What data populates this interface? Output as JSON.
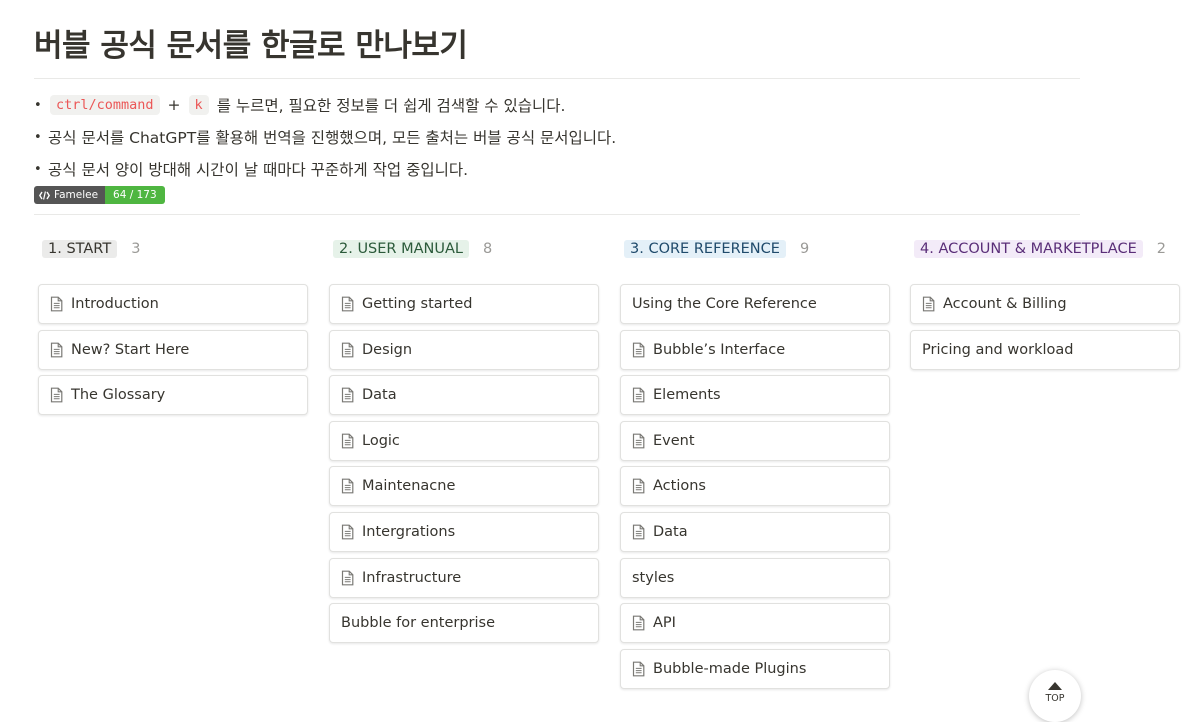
{
  "page": {
    "title": "버블 공식 문서를 한글로 만나보기"
  },
  "intro": {
    "line1": {
      "code1": "ctrl/command",
      "plus": "+",
      "code2": "k",
      "text": "를 누르면, 필요한 정보를 더 쉽게 검색할 수 있습니다."
    },
    "line2": "공식 문서를 ChatGPT를 활용해 번역을 진행했으며, 모든 출처는 버블 공식 문서입니다.",
    "line3": "공식 문서 양이 방대해 시간이 날 때마다 꾸준하게 작업 중입니다."
  },
  "badge": {
    "label": "Famelee",
    "value": "64 / 173"
  },
  "board": {
    "columns": [
      {
        "label": "1. START",
        "count": "3",
        "color": "#ebebea",
        "text_color": "#37352f",
        "items": [
          {
            "title": "Introduction",
            "icon": "page-icon"
          },
          {
            "title": "New? Start Here",
            "icon": "page-icon"
          },
          {
            "title": "The Glossary",
            "icon": "page-icon"
          }
        ]
      },
      {
        "label": "2. USER MANUAL",
        "count": "8",
        "color": "#e6f2e9",
        "text_color": "#2b5a3a",
        "items": [
          {
            "title": "Getting started",
            "icon": "page-icon"
          },
          {
            "title": "Design",
            "icon": "page-icon"
          },
          {
            "title": "Data",
            "icon": "page-icon"
          },
          {
            "title": "Logic",
            "icon": "page-icon"
          },
          {
            "title": "Maintenacne",
            "icon": "page-icon"
          },
          {
            "title": "Intergrations",
            "icon": "page-icon"
          },
          {
            "title": "Infrastructure",
            "icon": "page-icon"
          },
          {
            "title": "Bubble for enterprise",
            "icon": ""
          }
        ]
      },
      {
        "label": "3. CORE REFERENCE",
        "count": "9",
        "color": "#e4f0f8",
        "text_color": "#1f4a6b",
        "items": [
          {
            "title": "Using the Core Reference",
            "icon": ""
          },
          {
            "title": "Bubble’s Interface",
            "icon": "page-icon"
          },
          {
            "title": "Elements",
            "icon": "page-icon"
          },
          {
            "title": "Event",
            "icon": "page-icon"
          },
          {
            "title": "Actions",
            "icon": "page-icon"
          },
          {
            "title": "Data",
            "icon": "page-icon"
          },
          {
            "title": "styles",
            "icon": ""
          },
          {
            "title": "API",
            "icon": "page-icon"
          },
          {
            "title": "Bubble-made Plugins",
            "icon": "page-icon"
          }
        ]
      },
      {
        "label": "4. ACCOUNT & MARKETPLACE",
        "count": "2",
        "color": "#f3ebf8",
        "text_color": "#5a2e78",
        "items": [
          {
            "title": "Account & Billing",
            "icon": "page-icon"
          },
          {
            "title": "Pricing and workload",
            "icon": ""
          }
        ]
      }
    ]
  },
  "top_button": {
    "label": "TOP"
  }
}
